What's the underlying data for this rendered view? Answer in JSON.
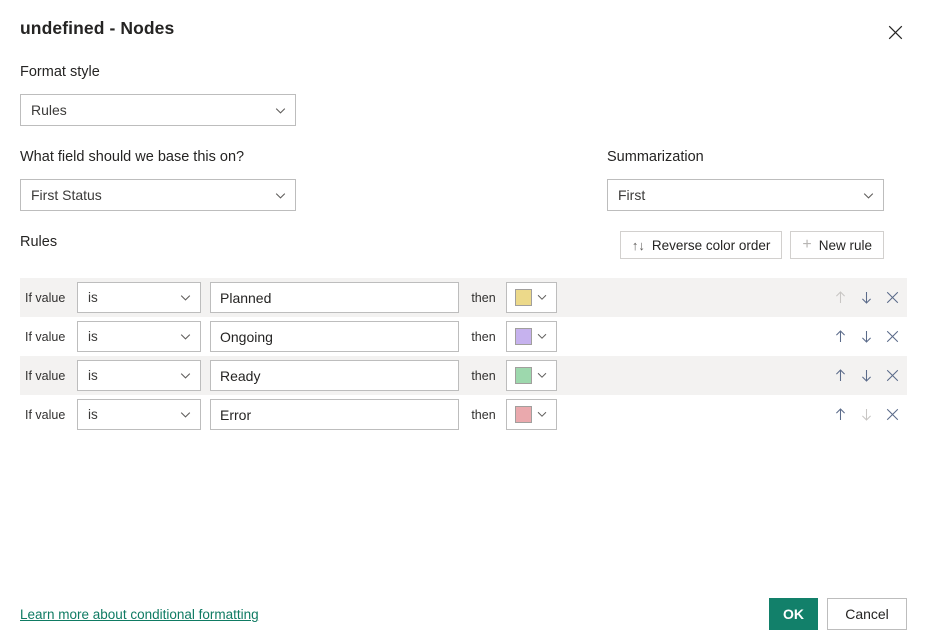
{
  "dialog": {
    "title": "undefined - Nodes",
    "close_icon": "close-icon"
  },
  "format_style": {
    "label": "Format style",
    "value": "Rules"
  },
  "base_field": {
    "label": "What field should we base this on?",
    "value": "First Status"
  },
  "summarization": {
    "label": "Summarization",
    "value": "First"
  },
  "rules": {
    "label": "Rules",
    "reverse_button": {
      "label": "Reverse color order",
      "icon": "sort-arrows-icon",
      "glyph": "↑↓"
    },
    "new_rule_button": {
      "label": "New rule",
      "icon": "plus-icon",
      "glyph": "+"
    },
    "if_value_label": "If value",
    "then_label": "then",
    "rows": [
      {
        "if_value": "If value",
        "operator": "is",
        "value": "Planned",
        "then": "then",
        "color": "#ecd98a",
        "move_up_enabled": false,
        "move_down_enabled": true
      },
      {
        "if_value": "If value",
        "operator": "is",
        "value": "Ongoing",
        "then": "then",
        "color": "#c6b2ee",
        "move_up_enabled": true,
        "move_down_enabled": true
      },
      {
        "if_value": "If value",
        "operator": "is",
        "value": "Ready",
        "then": "then",
        "color": "#9dd8ad",
        "move_up_enabled": true,
        "move_down_enabled": true
      },
      {
        "if_value": "If value",
        "operator": "is",
        "value": "Error",
        "then": "then",
        "color": "#eaa9ad",
        "move_up_enabled": true,
        "move_down_enabled": false
      }
    ]
  },
  "footer": {
    "learn_more_link": "Learn more about conditional formatting",
    "ok_label": "OK",
    "cancel_label": "Cancel"
  },
  "colors": {
    "accent": "#12806a",
    "link": "#0f7b63",
    "row_shade": "#f3f2f1",
    "border": "#bdbdbd"
  }
}
